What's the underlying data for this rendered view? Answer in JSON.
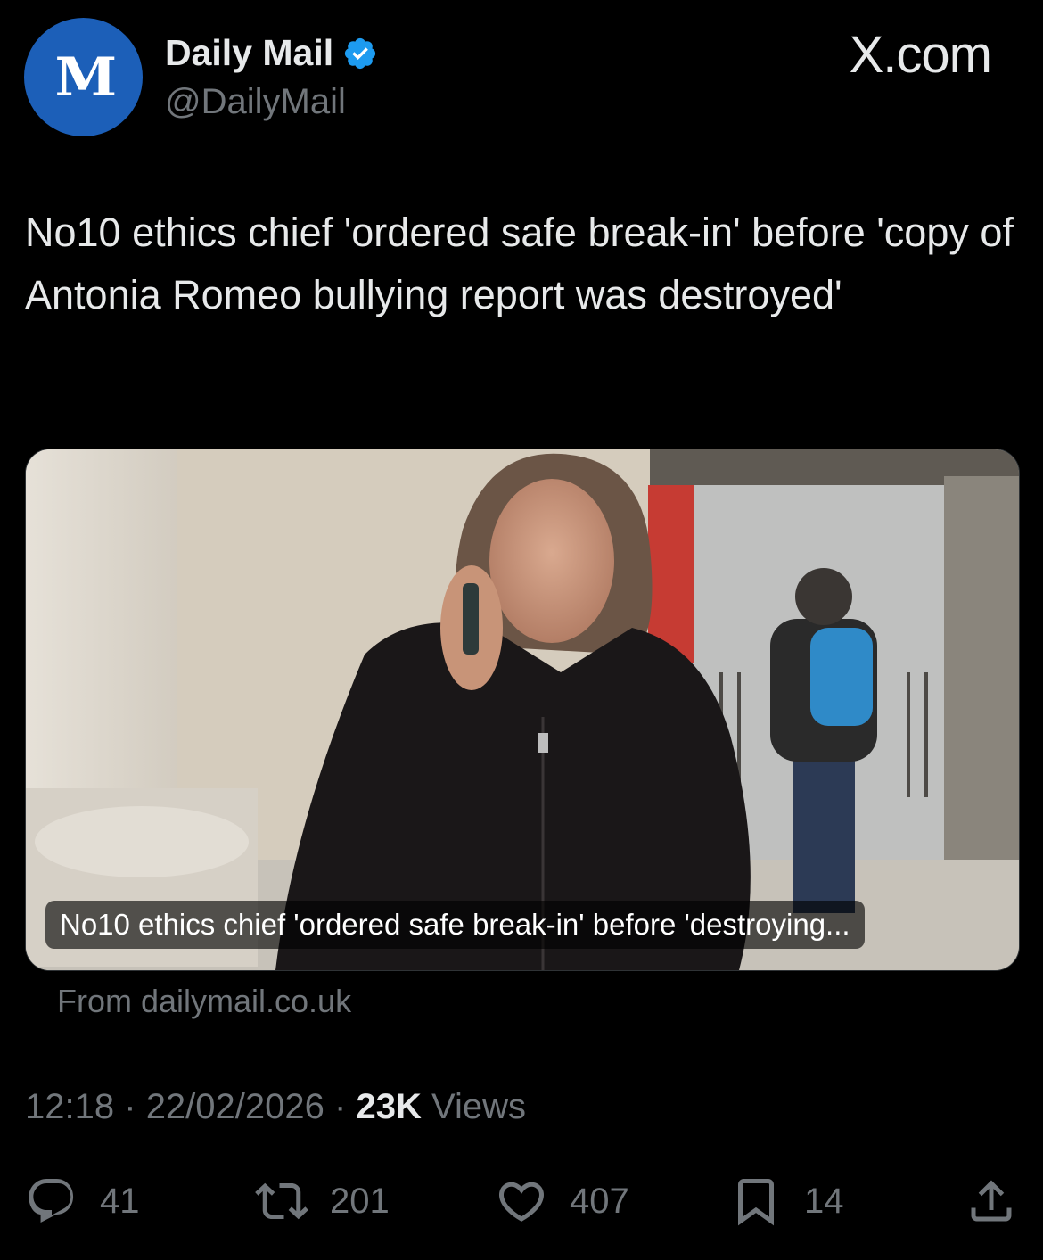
{
  "source_label": "X.com",
  "author": {
    "name": "Daily Mail",
    "handle": "@DailyMail",
    "avatar_text": "M",
    "verified": true,
    "avatar_color": "#1c5fb8",
    "verified_color": "#1d9bf0"
  },
  "tweet": {
    "text": "No10 ethics chief 'ordered safe break-in' before 'copy of Antonia Romeo bullying report was destroyed'"
  },
  "card": {
    "caption": "No10 ethics chief 'ordered safe break-in' before 'destroying...",
    "source": "From dailymail.co.uk"
  },
  "meta": {
    "time": "12:18",
    "date": "22/02/2026",
    "separator": "·",
    "views_count": "23K",
    "views_label": "Views"
  },
  "actions": {
    "replies": "41",
    "reposts": "201",
    "likes": "407",
    "bookmarks": "14"
  },
  "icons": {
    "reply": "reply-icon",
    "repost": "repost-icon",
    "like": "heart-icon",
    "bookmark": "bookmark-icon",
    "share": "share-icon"
  }
}
